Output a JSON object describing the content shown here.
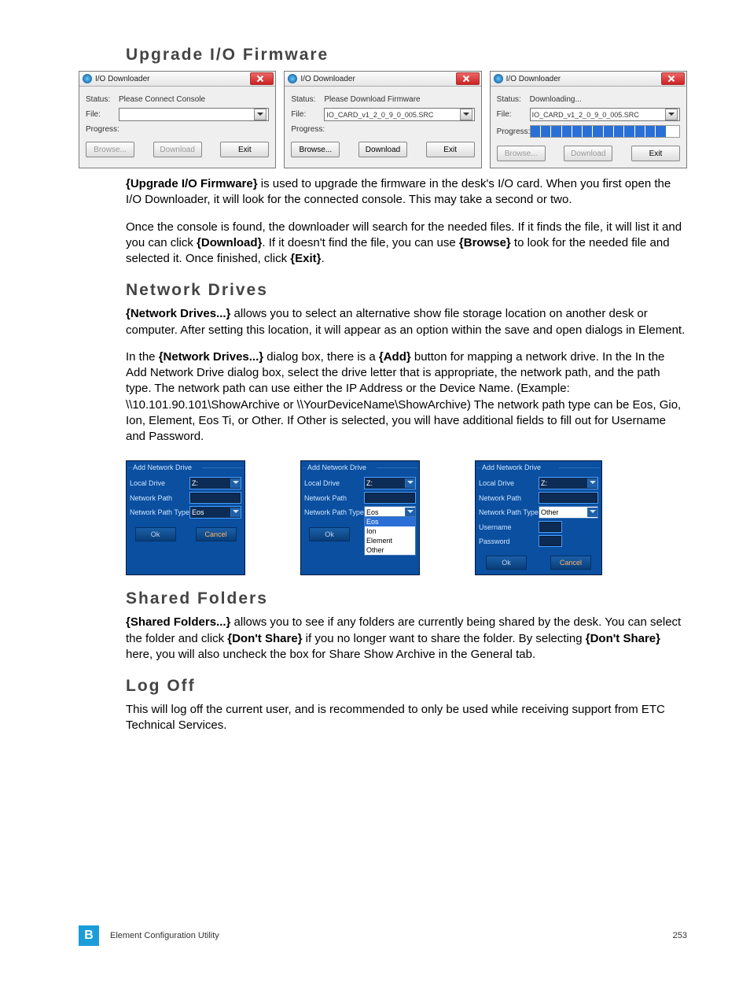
{
  "headings": {
    "upgrade": "Upgrade I/O Firmware",
    "network": "Network Drives",
    "shared": "Shared Folders",
    "logoff": "Log Off"
  },
  "io_windows": {
    "title": "I/O Downloader",
    "labels": {
      "status": "Status:",
      "file": "File:",
      "progress": "Progress:"
    },
    "buttons": {
      "browse": "Browse...",
      "download": "Download",
      "exit": "Exit"
    },
    "w1": {
      "status": "Please Connect Console",
      "file": ""
    },
    "w2": {
      "status": "Please Download Firmware",
      "file": "IO_CARD_v1_2_0_9_0_005.SRC"
    },
    "w3": {
      "status": "Downloading...",
      "file": "IO_CARD_v1_2_0_9_0_005.SRC"
    }
  },
  "paragraphs": {
    "p1a": "{Upgrade I/O Firmware}",
    "p1b": " is used to upgrade the firmware in the desk's I/O card. When you first open the I/O Downloader, it will look for the connected console. This may take a second or two.",
    "p2a": "Once the console is found, the downloader will search for the needed files. If it finds the file, it will list it and you can click ",
    "p2b": "{Download}",
    "p2c": ". If it doesn't find the file, you can use ",
    "p2d": "{Browse}",
    "p2e": " to look for the needed file and selected it. Once finished, click ",
    "p2f": "{Exit}",
    "p2g": ".",
    "p3a": "{Network Drives...}",
    "p3b": " allows you to select an alternative show file storage location on another desk or computer. After setting this location, it will appear as an option within the save and open dialogs in Element.",
    "p4a": "In the ",
    "p4b": "{Network Drives...}",
    "p4c": " dialog box, there is a ",
    "p4d": "{Add}",
    "p4e": " button for mapping a network drive. In the In the Add Network Drive dialog box, select the drive letter that is appropriate, the network path, and the path type. The network path can use either the IP Address or the Device Name. (Example: \\\\10.101.90.101\\ShowArchive or \\\\YourDeviceName\\ShowArchive) The network path type can be Eos, Gio, Ion, Element, Eos Ti, or Other. If Other is selected, you will have additional fields to fill out for Username and Password.",
    "p5a": "{Shared Folders...}",
    "p5b": " allows you to see if any folders are currently being shared by the desk. You can select the folder and click ",
    "p5c": "{Don't Share}",
    "p5d": " if you no longer want to share the folder. By selecting ",
    "p5e": "{Don't Share}",
    "p5f": " here, you will also uncheck the box for Share Show Archive in the General tab.",
    "p6": "This will log off the current user, and is recommended to only be used while receiving support from ETC Technical Services."
  },
  "blue": {
    "title": "Add Network Drive",
    "labels": {
      "local": "Local Drive",
      "np": "Network Path",
      "npt": "Network Path Type",
      "user": "Username",
      "pass": "Password"
    },
    "drive": "Z:",
    "type_eos": "Eos",
    "type_other": "Other",
    "dropdown": [
      "Eos",
      "Ion",
      "Element",
      "Other"
    ],
    "ok": "Ok",
    "cancel": "Cancel"
  },
  "footer": {
    "badge": "B",
    "text": "Element Configuration Utility",
    "page": "253"
  }
}
